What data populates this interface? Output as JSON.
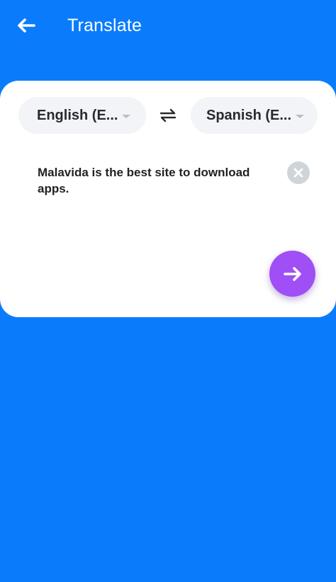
{
  "app_bar": {
    "title": "Translate",
    "back_icon": "arrow-left-icon"
  },
  "translator": {
    "source_language": "English (E...",
    "target_language": "Spanish (E...",
    "swap_icon": "swap-arrows-icon",
    "input_text": "Malavida is the best site to download apps.",
    "clear_icon": "close-icon",
    "translate_icon": "arrow-right-icon"
  },
  "colors": {
    "background": "#0a7cfb",
    "card": "#ffffff",
    "pill": "#f2f4f7",
    "translate_button": "#a04ef5",
    "clear_button": "#cfd3da"
  }
}
